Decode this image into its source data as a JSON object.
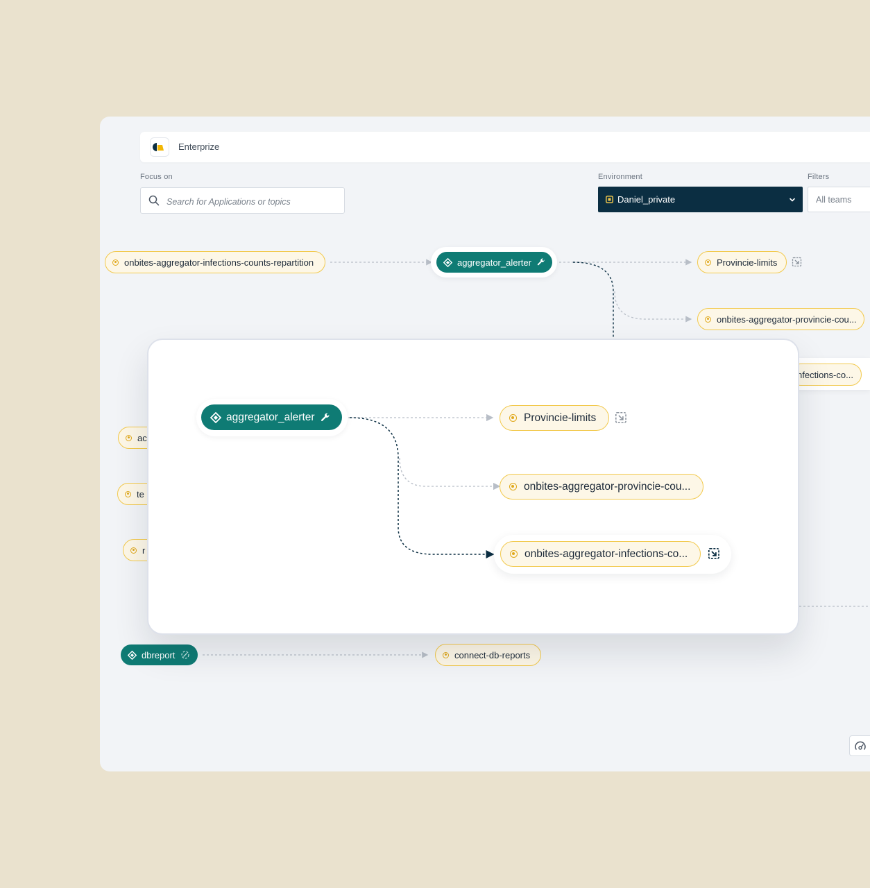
{
  "topbar": {
    "org_name": "Enterprize"
  },
  "focus": {
    "label": "Focus on",
    "placeholder": "Search for Applications or topics"
  },
  "environment": {
    "label": "Environment",
    "selected": "Daniel_private"
  },
  "filters": {
    "label": "Filters",
    "selected": "All teams"
  },
  "graph": {
    "topics": {
      "repartition": "onbites-aggregator-infections-counts-repartition",
      "provincie_limits": "Provincie-limits",
      "provincie_cou": "onbites-aggregator-provincie-cou...",
      "infections_co_partial": "nfections-co...",
      "partial_1": "ac",
      "partial_2": "te",
      "partial_3": "r",
      "connect_db_reports": "connect-db-reports"
    },
    "apps": {
      "aggregator_alerter": "aggregator_alerter",
      "dbreport": "dbreport"
    }
  },
  "zoom_panel": {
    "app": "aggregator_alerter",
    "topics": {
      "provincie_limits": "Provincie-limits",
      "provincie_cou": "onbites-aggregator-provincie-cou...",
      "infections_co": "onbites-aggregator-infections-co..."
    }
  },
  "colors": {
    "background": "#EAE2CE",
    "canvas": "#F2F4F7",
    "app_node": "#0F7B74",
    "topic_border": "#F2C94C",
    "topic_fill": "#FDF7E7",
    "environment_bg": "#0B2E42"
  },
  "icons": [
    "search-icon",
    "chevron-down-icon",
    "environment-icon",
    "diamond-icon",
    "wrench-icon",
    "open-in-new-icon",
    "topic-icon",
    "gauge-icon"
  ]
}
